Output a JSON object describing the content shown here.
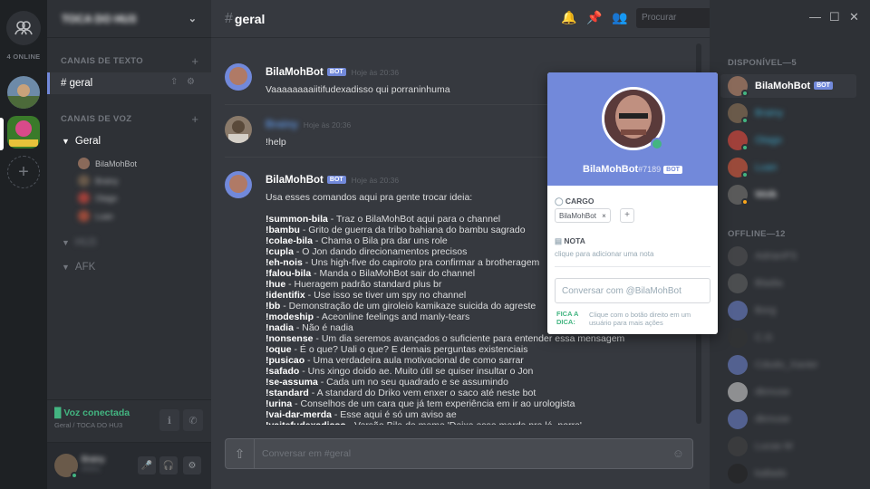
{
  "colors": {
    "accent": "#7289da",
    "online": "#43b581",
    "idle": "#faa61a",
    "bg_dark": "#1e2124"
  },
  "guilds": {
    "online_label": "4 ONLINE",
    "add_icon": "plus-icon"
  },
  "server": {
    "name": "TOCA DO HU3"
  },
  "channels": {
    "text_category": "CANAIS DE TEXTO",
    "text_channels": [
      {
        "name": "# geral"
      }
    ],
    "voice_category": "CANAIS DE VOZ",
    "voice_channels": [
      {
        "name": "Geral",
        "users": [
          "BilaMohBot",
          "Brainy",
          "Otago",
          "Luan"
        ]
      },
      {
        "name": "HU3"
      },
      {
        "name": "AFK"
      }
    ]
  },
  "voice_status": {
    "title": "Voz conectada",
    "subtitle": "Geral / TOCA DO HU3"
  },
  "user_panel": {
    "name": "Brainy",
    "tag": "#0001"
  },
  "chat": {
    "channel": "geral",
    "hash": "#",
    "search_placeholder": "Procurar",
    "composer_placeholder": "Conversar em #geral",
    "messages": [
      {
        "author": "BilaMohBot",
        "bot_tag": "BOT",
        "time": "Hoje às 20:36",
        "text": "Vaaaaaaaaiitifudexadisso qui porraninhuma"
      },
      {
        "author": "Brainy",
        "time": "Hoje às 20:36",
        "text": "!help"
      },
      {
        "author": "BilaMohBot",
        "bot_tag": "BOT",
        "time": "Hoje às 20:36",
        "text": "Usa esses comandos aqui pra gente trocar ideia:"
      }
    ],
    "commands": [
      {
        "cmd": "!summon-bila",
        "desc": " - Traz o BilaMohBot aqui para o channel"
      },
      {
        "cmd": "!bambu",
        "desc": " - Grito de guerra da tribo bahiana do bambu sagrado"
      },
      {
        "cmd": "!colae-bila",
        "desc": " - Chama o Bila pra dar uns role"
      },
      {
        "cmd": "!cupla",
        "desc": " - O Jon dando direcionamentos precisos"
      },
      {
        "cmd": "!eh-nois",
        "desc": " - Uns high-five do capiroto pra confirmar a brotheragem"
      },
      {
        "cmd": "!falou-bila",
        "desc": " - Manda o BilaMohBot sair do channel"
      },
      {
        "cmd": "!hue",
        "desc": " - Hueragem padrão standard plus br"
      },
      {
        "cmd": "!identifix",
        "desc": " - Use isso se tiver um spy no channel"
      },
      {
        "cmd": "!bb",
        "desc": " - Demonstração de um giroleio kamikaze suicida do agreste"
      },
      {
        "cmd": "!modeship",
        "desc": " - Aceonline feelings and manly-tears"
      },
      {
        "cmd": "!nadia",
        "desc": " - Não é nadia"
      },
      {
        "cmd": "!nonsense",
        "desc": " - Um dia seremos avançados o suficiente para entender essa mensagem"
      },
      {
        "cmd": "!oque",
        "desc": " - É o que? Uali o que? E demais perguntas existenciais"
      },
      {
        "cmd": "!pusicao",
        "desc": " - Uma verdadeira aula motivacional de como sarrar"
      },
      {
        "cmd": "!safado",
        "desc": " - Uns xingo doido ae. Muito útil se quiser insultar o Jon"
      },
      {
        "cmd": "!se-assuma",
        "desc": " - Cada um no seu quadrado e se assumindo"
      },
      {
        "cmd": "!standard",
        "desc": " - A standard do Driko vem enxer o saco até neste bot"
      },
      {
        "cmd": "!urina",
        "desc": " - Conselhos de um cara que já tem experiência em ir ao urologista"
      },
      {
        "cmd": "!vai-dar-merda",
        "desc": " - Esse aqui é só um aviso ae"
      },
      {
        "cmd": "!vaitefudexadisso",
        "desc": " - Versão Bila do meme 'Deixa essa merda pra lá, porra'"
      }
    ]
  },
  "members": {
    "online_header": "DISPONÍVEL—5",
    "offline_header": "OFFLINE—12",
    "online": [
      {
        "name": "BilaMohBot",
        "bot": "BOT",
        "status": "#43b581",
        "avatar": "#8a6a5a"
      },
      {
        "name": "Brainy",
        "status": "#43b581",
        "avatar": "#6a5a4a"
      },
      {
        "name": "Otago",
        "status": "#43b581",
        "avatar": "#a0403a"
      },
      {
        "name": "Luan",
        "status": "#43b581",
        "avatar": "#9a4a3a"
      },
      {
        "name": "Wolk",
        "status": "#faa61a",
        "avatar": "#5a5a5a"
      }
    ],
    "offline": [
      {
        "name": "AdrianPS",
        "avatar": "#555"
      },
      {
        "name": "Bladia",
        "avatar": "#666"
      },
      {
        "name": "Borg",
        "avatar": "#7289da"
      },
      {
        "name": "C.G",
        "avatar": "#333"
      },
      {
        "name": "Cdudo_Xavier",
        "avatar": "#7289da"
      },
      {
        "name": "dkmuse",
        "avatar": "#ddd"
      },
      {
        "name": "dkmuse",
        "avatar": "#7289da"
      },
      {
        "name": "Lucas M",
        "avatar": "#444"
      },
      {
        "name": "kallado",
        "avatar": "#222"
      }
    ]
  },
  "popout": {
    "name": "BilaMohBot",
    "discriminator": "#7189",
    "bot_tag": "BOT",
    "role_label": "CARGO",
    "role": "BilaMohBot",
    "note_label": "NOTA",
    "note_placeholder": "clique para adicionar uma nota",
    "dm_placeholder": "Conversar com @BilaMohBot",
    "tip_title": "FICA A DICA:",
    "tip_text": "Clique com o botão direito em um usuário para mais ações"
  }
}
